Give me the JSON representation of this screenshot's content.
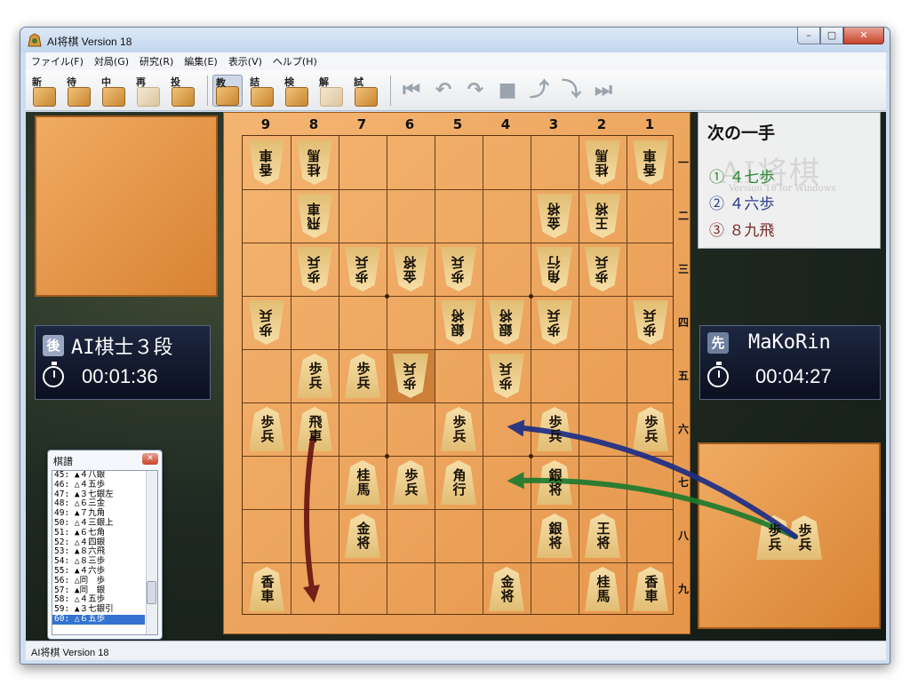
{
  "window": {
    "title": "AI将棋 Version 18"
  },
  "menu": [
    "ファイル(F)",
    "対局(G)",
    "研究(R)",
    "編集(E)",
    "表示(V)",
    "ヘルプ(H)"
  ],
  "toolbar": {
    "buttons": [
      {
        "label": "新",
        "name": "new-game-button",
        "icon": "new-board-icon",
        "state": "enabled"
      },
      {
        "label": "待",
        "name": "undo-wait-button",
        "icon": "hand-stop-icon",
        "state": "enabled"
      },
      {
        "label": "中",
        "name": "pause-button",
        "icon": "pause-icon",
        "state": "enabled"
      },
      {
        "label": "再",
        "name": "resume-button",
        "icon": "resume-icon",
        "state": "disabled"
      },
      {
        "label": "投",
        "name": "resign-button",
        "icon": "resign-icon",
        "state": "enabled"
      },
      {
        "label": "教",
        "name": "teach-button",
        "icon": "book-icon",
        "state": "active"
      },
      {
        "label": "詰",
        "name": "tsume-button",
        "icon": "question-icon",
        "state": "enabled"
      },
      {
        "label": "検",
        "name": "analyze-button",
        "icon": "magnifier-icon",
        "state": "enabled"
      },
      {
        "label": "解",
        "name": "solve-button",
        "icon": "solve-icon",
        "state": "disabled"
      },
      {
        "label": "試",
        "name": "test-button",
        "icon": "test-icon",
        "state": "enabled"
      }
    ],
    "nav": [
      {
        "glyph": "⏮",
        "name": "first-move-button"
      },
      {
        "glyph": "↶",
        "name": "back-button"
      },
      {
        "glyph": "↷",
        "name": "forward-button"
      },
      {
        "glyph": "■",
        "name": "stop-button"
      },
      {
        "glyph": "⤴",
        "name": "step-button"
      },
      {
        "glyph": "⤵",
        "name": "step-next-button"
      },
      {
        "glyph": "⏭",
        "name": "last-move-button"
      }
    ]
  },
  "board": {
    "col_labels": [
      "9",
      "8",
      "7",
      "6",
      "5",
      "4",
      "3",
      "2",
      "1"
    ],
    "row_labels": [
      "一",
      "二",
      "三",
      "四",
      "五",
      "六",
      "七",
      "八",
      "九"
    ],
    "last_move": {
      "col": 6,
      "row": 5
    },
    "pieces": [
      {
        "c": 9,
        "r": 1,
        "t": "香車",
        "side": "gote"
      },
      {
        "c": 8,
        "r": 1,
        "t": "桂馬",
        "side": "gote"
      },
      {
        "c": 2,
        "r": 1,
        "t": "桂馬",
        "side": "gote"
      },
      {
        "c": 1,
        "r": 1,
        "t": "香車",
        "side": "gote"
      },
      {
        "c": 8,
        "r": 2,
        "t": "飛車",
        "side": "gote"
      },
      {
        "c": 3,
        "r": 2,
        "t": "金将",
        "side": "gote"
      },
      {
        "c": 2,
        "r": 2,
        "t": "王将",
        "side": "gote"
      },
      {
        "c": 8,
        "r": 3,
        "t": "歩兵",
        "side": "gote"
      },
      {
        "c": 7,
        "r": 3,
        "t": "歩兵",
        "side": "gote"
      },
      {
        "c": 6,
        "r": 3,
        "t": "金将",
        "side": "gote"
      },
      {
        "c": 5,
        "r": 3,
        "t": "歩兵",
        "side": "gote"
      },
      {
        "c": 3,
        "r": 3,
        "t": "角行",
        "side": "gote"
      },
      {
        "c": 2,
        "r": 3,
        "t": "歩兵",
        "side": "gote"
      },
      {
        "c": 9,
        "r": 4,
        "t": "歩兵",
        "side": "gote"
      },
      {
        "c": 5,
        "r": 4,
        "t": "銀将",
        "side": "gote"
      },
      {
        "c": 4,
        "r": 4,
        "t": "銀将",
        "side": "gote"
      },
      {
        "c": 3,
        "r": 4,
        "t": "歩兵",
        "side": "gote"
      },
      {
        "c": 1,
        "r": 4,
        "t": "歩兵",
        "side": "gote"
      },
      {
        "c": 6,
        "r": 5,
        "t": "歩兵",
        "side": "gote"
      },
      {
        "c": 4,
        "r": 5,
        "t": "歩兵",
        "side": "gote"
      },
      {
        "c": 8,
        "r": 5,
        "t": "歩兵",
        "side": "sente"
      },
      {
        "c": 7,
        "r": 5,
        "t": "歩兵",
        "side": "sente"
      },
      {
        "c": 9,
        "r": 6,
        "t": "歩兵",
        "side": "sente"
      },
      {
        "c": 8,
        "r": 6,
        "t": "飛車",
        "side": "sente"
      },
      {
        "c": 5,
        "r": 6,
        "t": "歩兵",
        "side": "sente"
      },
      {
        "c": 3,
        "r": 6,
        "t": "歩兵",
        "side": "sente"
      },
      {
        "c": 1,
        "r": 6,
        "t": "歩兵",
        "side": "sente"
      },
      {
        "c": 7,
        "r": 7,
        "t": "桂馬",
        "side": "sente"
      },
      {
        "c": 6,
        "r": 7,
        "t": "歩兵",
        "side": "sente"
      },
      {
        "c": 5,
        "r": 7,
        "t": "角行",
        "side": "sente"
      },
      {
        "c": 3,
        "r": 7,
        "t": "銀将",
        "side": "sente"
      },
      {
        "c": 7,
        "r": 8,
        "t": "金将",
        "side": "sente"
      },
      {
        "c": 3,
        "r": 8,
        "t": "銀将",
        "side": "sente"
      },
      {
        "c": 2,
        "r": 8,
        "t": "王将",
        "side": "sente"
      },
      {
        "c": 9,
        "r": 9,
        "t": "香車",
        "side": "sente"
      },
      {
        "c": 4,
        "r": 9,
        "t": "金将",
        "side": "sente"
      },
      {
        "c": 2,
        "r": 9,
        "t": "桂馬",
        "side": "sente"
      },
      {
        "c": 1,
        "r": 9,
        "t": "香車",
        "side": "sente"
      }
    ]
  },
  "players": {
    "gote": {
      "badge": "後",
      "name": "AI棋士３段",
      "time": "00:01:36",
      "badge_color": "#9aa6c2"
    },
    "sente": {
      "badge": "先",
      "name": "MaKoRin",
      "time": "00:04:27",
      "badge_color": "#6e7f9e"
    }
  },
  "hands": {
    "sente": [
      {
        "t": "歩兵"
      },
      {
        "t": "歩兵"
      }
    ]
  },
  "hint": {
    "title": "次の一手",
    "watermark": "AI将棋",
    "watermark_sub": "Version 18 for Windows",
    "moves": [
      {
        "text": "① ４七歩",
        "color": "#2a8a36"
      },
      {
        "text": "② ４六歩",
        "color": "#2b3a8c"
      },
      {
        "text": "③ ８九飛",
        "color": "#7a2828"
      }
    ]
  },
  "arrows": [
    {
      "from": [
        2,
        8
      ],
      "to": [
        4,
        7
      ],
      "color": "#1f7a2e"
    },
    {
      "from": [
        2,
        8
      ],
      "to": [
        4,
        6
      ],
      "color": "#1e2e86"
    },
    {
      "from": [
        8,
        6
      ],
      "to": [
        8,
        9
      ],
      "color": "#6a1414"
    }
  ],
  "kifu": {
    "title": "棋譜",
    "lines": [
      "45: ▲４八銀",
      "46: △４五歩",
      "47: ▲３七銀左",
      "48: △６三金",
      "49: ▲７九角",
      "50: △４三銀上",
      "51: ▲６七角",
      "52: △４四銀",
      "53: ▲８六飛",
      "54: △８三歩",
      "55: ▲４六歩",
      "56: △同　歩",
      "57: ▲同　銀",
      "58: △４五歩",
      "59: ▲３七銀引",
      "60: △６五歩"
    ],
    "selected": 15
  },
  "status": {
    "text": "AI将棋 Version 18"
  }
}
